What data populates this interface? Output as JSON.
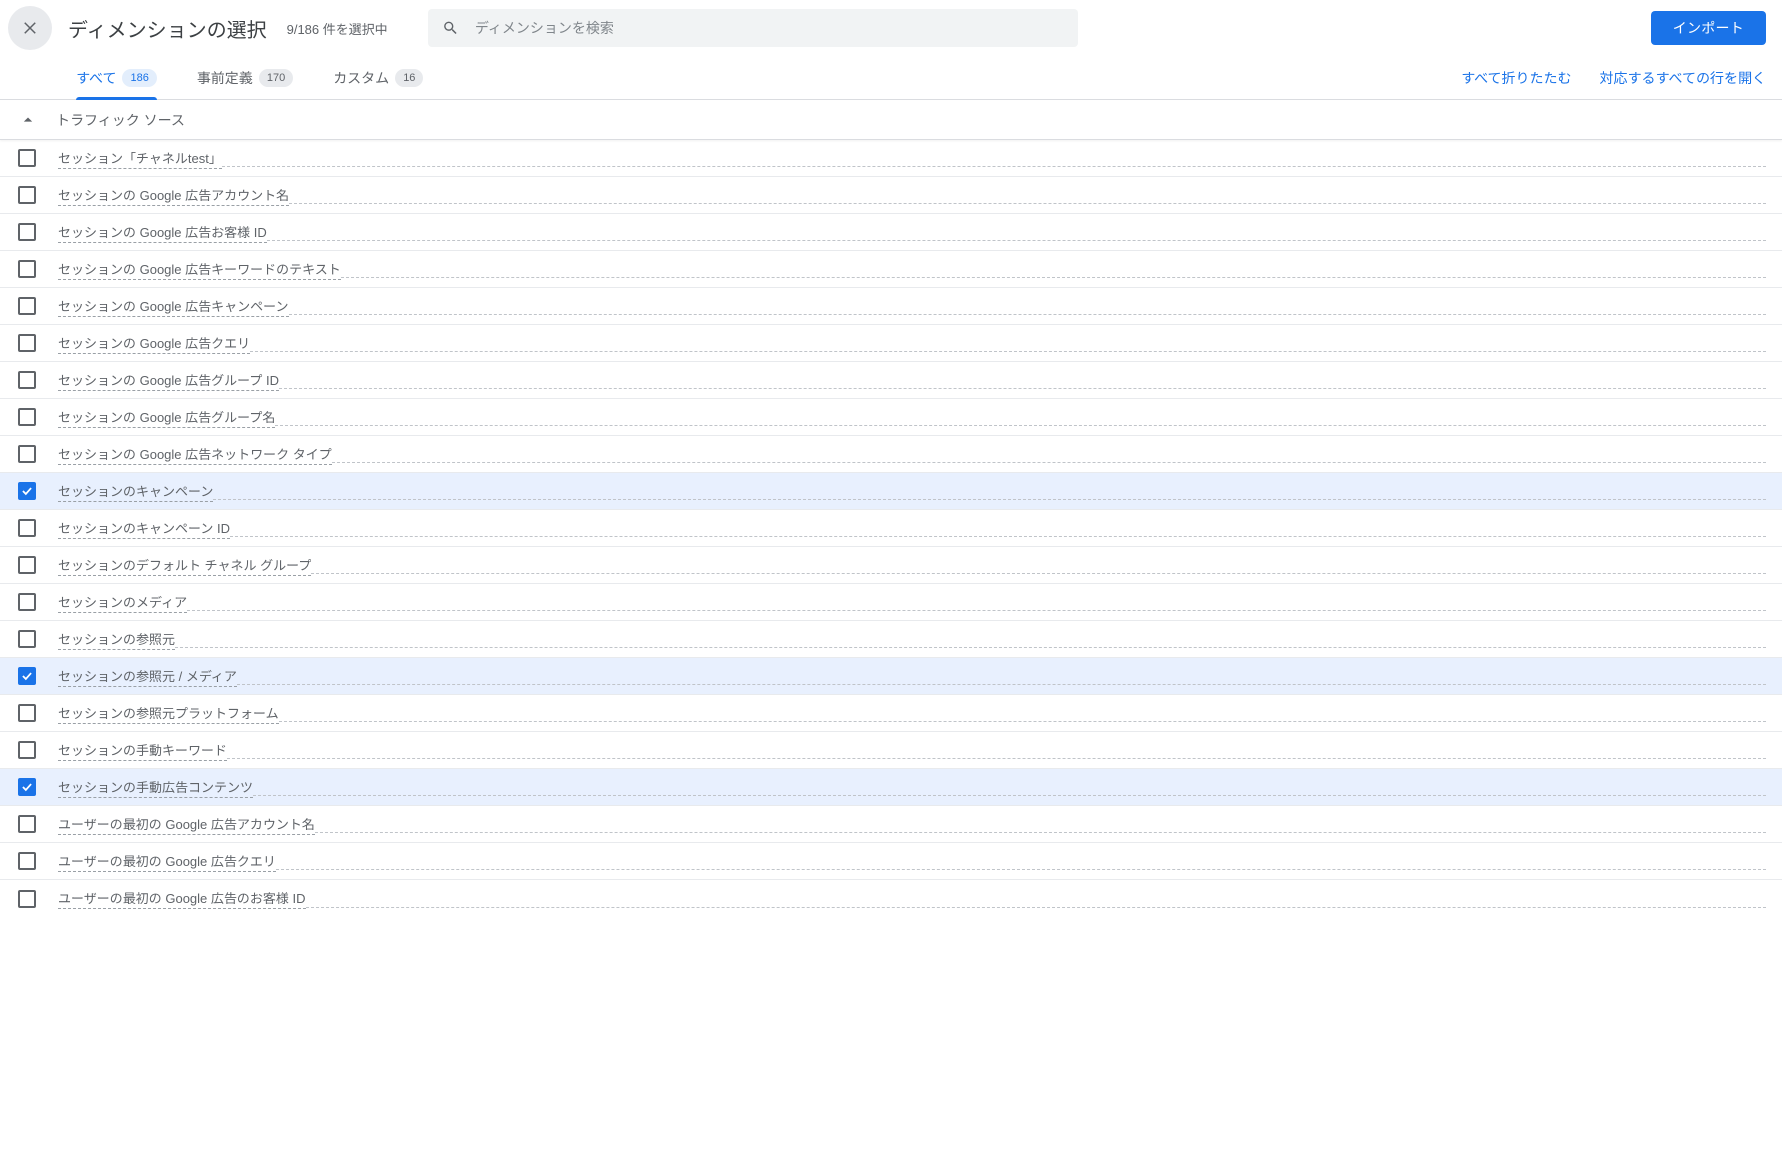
{
  "header": {
    "title": "ディメンションの選択",
    "subtitle": "9/186 件を選択中",
    "search_placeholder": "ディメンションを検索",
    "import_label": "インポート"
  },
  "tabs": [
    {
      "label": "すべて",
      "count": "186",
      "active": true
    },
    {
      "label": "事前定義",
      "count": "170",
      "active": false
    },
    {
      "label": "カスタム",
      "count": "16",
      "active": false
    }
  ],
  "actions": {
    "collapse_all": "すべて折りたたむ",
    "expand_matching": "対応するすべての行を開く"
  },
  "group": {
    "title": "トラフィック ソース"
  },
  "items": [
    {
      "label": "セッション「チャネルtest」",
      "checked": false
    },
    {
      "label": "セッションの Google 広告アカウント名",
      "checked": false
    },
    {
      "label": "セッションの Google 広告お客様 ID",
      "checked": false
    },
    {
      "label": "セッションの Google 広告キーワードのテキスト",
      "checked": false
    },
    {
      "label": "セッションの Google 広告キャンペーン",
      "checked": false
    },
    {
      "label": "セッションの Google 広告クエリ",
      "checked": false
    },
    {
      "label": "セッションの Google 広告グループ ID",
      "checked": false
    },
    {
      "label": "セッションの Google 広告グループ名",
      "checked": false
    },
    {
      "label": "セッションの Google 広告ネットワーク タイプ",
      "checked": false
    },
    {
      "label": "セッションのキャンペーン",
      "checked": true
    },
    {
      "label": "セッションのキャンペーン ID",
      "checked": false
    },
    {
      "label": "セッションのデフォルト チャネル グループ",
      "checked": false
    },
    {
      "label": "セッションのメディア",
      "checked": false
    },
    {
      "label": "セッションの参照元",
      "checked": false
    },
    {
      "label": "セッションの参照元 / メディア",
      "checked": true
    },
    {
      "label": "セッションの参照元プラットフォーム",
      "checked": false
    },
    {
      "label": "セッションの手動キーワード",
      "checked": false
    },
    {
      "label": "セッションの手動広告コンテンツ",
      "checked": true
    },
    {
      "label": "ユーザーの最初の Google 広告アカウント名",
      "checked": false
    },
    {
      "label": "ユーザーの最初の Google 広告クエリ",
      "checked": false
    },
    {
      "label": "ユーザーの最初の Google 広告のお客様 ID",
      "checked": false
    }
  ]
}
